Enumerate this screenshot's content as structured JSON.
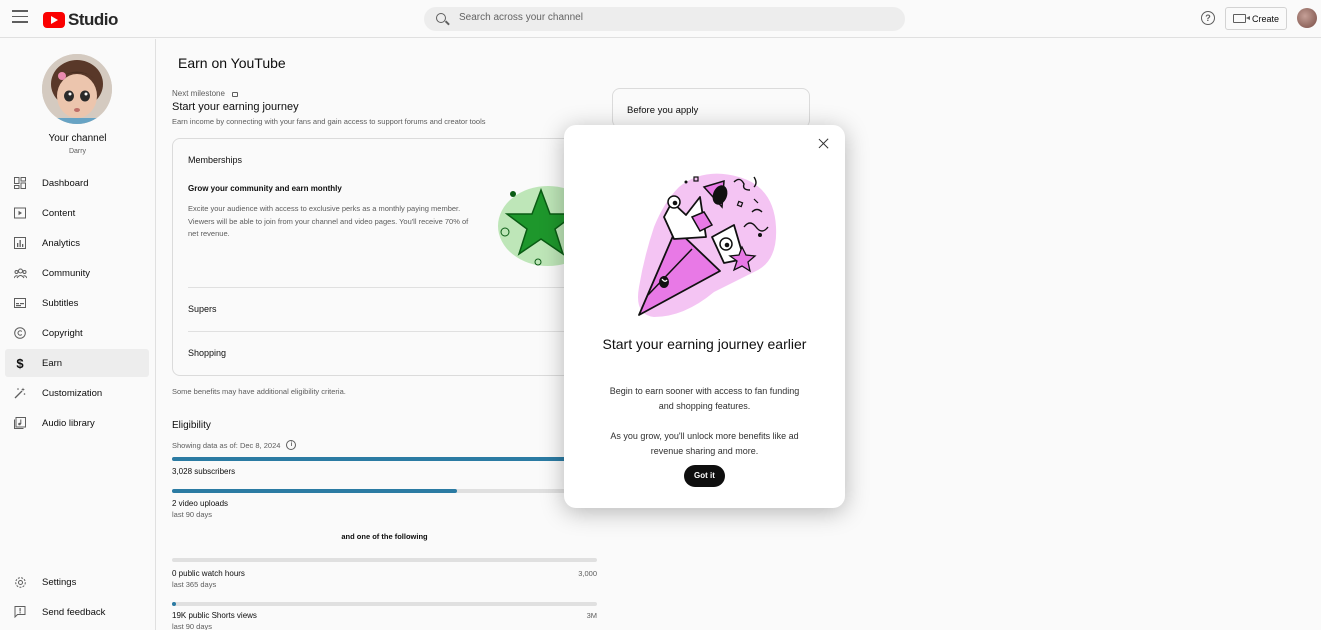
{
  "topbar": {
    "logo_text": "Studio",
    "search_placeholder": "Search across your channel",
    "help_glyph": "?",
    "create_label": "Create"
  },
  "sidebar": {
    "channel_name": "Your channel",
    "channel_handle": "Darry",
    "items": [
      {
        "label": "Dashboard",
        "icon": "dashboard-icon"
      },
      {
        "label": "Content",
        "icon": "content-icon"
      },
      {
        "label": "Analytics",
        "icon": "analytics-icon"
      },
      {
        "label": "Community",
        "icon": "community-icon"
      },
      {
        "label": "Subtitles",
        "icon": "subtitles-icon"
      },
      {
        "label": "Copyright",
        "icon": "copyright-icon"
      },
      {
        "label": "Earn",
        "icon": "dollar-icon",
        "active": true
      },
      {
        "label": "Customization",
        "icon": "magic-wand-icon"
      },
      {
        "label": "Audio library",
        "icon": "audio-library-icon"
      }
    ],
    "bottom_items": [
      {
        "label": "Settings",
        "icon": "gear-icon"
      },
      {
        "label": "Send feedback",
        "icon": "feedback-icon"
      }
    ]
  },
  "main": {
    "page_title": "Earn on YouTube",
    "milestone_label": "Next milestone",
    "journey_title": "Start your earning journey",
    "journey_desc": "Earn income by connecting with your fans and gain access to support forums and creator tools",
    "benefits": {
      "memberships_title": "Memberships",
      "memberships_sub": "Grow your community and earn monthly",
      "memberships_desc": "Excite your audience with access to exclusive perks as a monthly paying member. Viewers will be able to join from your channel and video pages. You'll receive 70% of net revenue.",
      "supers_title": "Supers",
      "shopping_title": "Shopping"
    },
    "criteria_note": "Some benefits may have additional eligibility criteria.",
    "before_you_apply": "Before you apply",
    "eligibility": {
      "title": "Eligibility",
      "data_as_of": "Showing data as of: Dec 8, 2024",
      "subscribers": {
        "label": "3,028 subscribers",
        "progress": 1.0
      },
      "uploads": {
        "label": "2 video uploads",
        "sub": "last 90 days",
        "progress": 0.67
      },
      "and_one": "and one of the following",
      "watch_hours": {
        "label": "0 public watch hours",
        "sub": "last 365 days",
        "target": "3,000",
        "progress": 0.0
      },
      "shorts_views": {
        "label": "19K public Shorts views",
        "sub": "last 90 days",
        "target": "3M",
        "progress": 0.01
      }
    }
  },
  "modal": {
    "title": "Start your earning journey earlier",
    "text1": "Begin to earn sooner with access to fan funding and shopping features.",
    "text2": "As you grow, you'll unlock more benefits like ad revenue sharing and more.",
    "button_label": "Got it"
  },
  "colors": {
    "brand_red": "#ff0000",
    "progress_blue": "#2c7ea7",
    "illustration_pink": "#e879e6",
    "star_green": "#1f9b2d"
  }
}
